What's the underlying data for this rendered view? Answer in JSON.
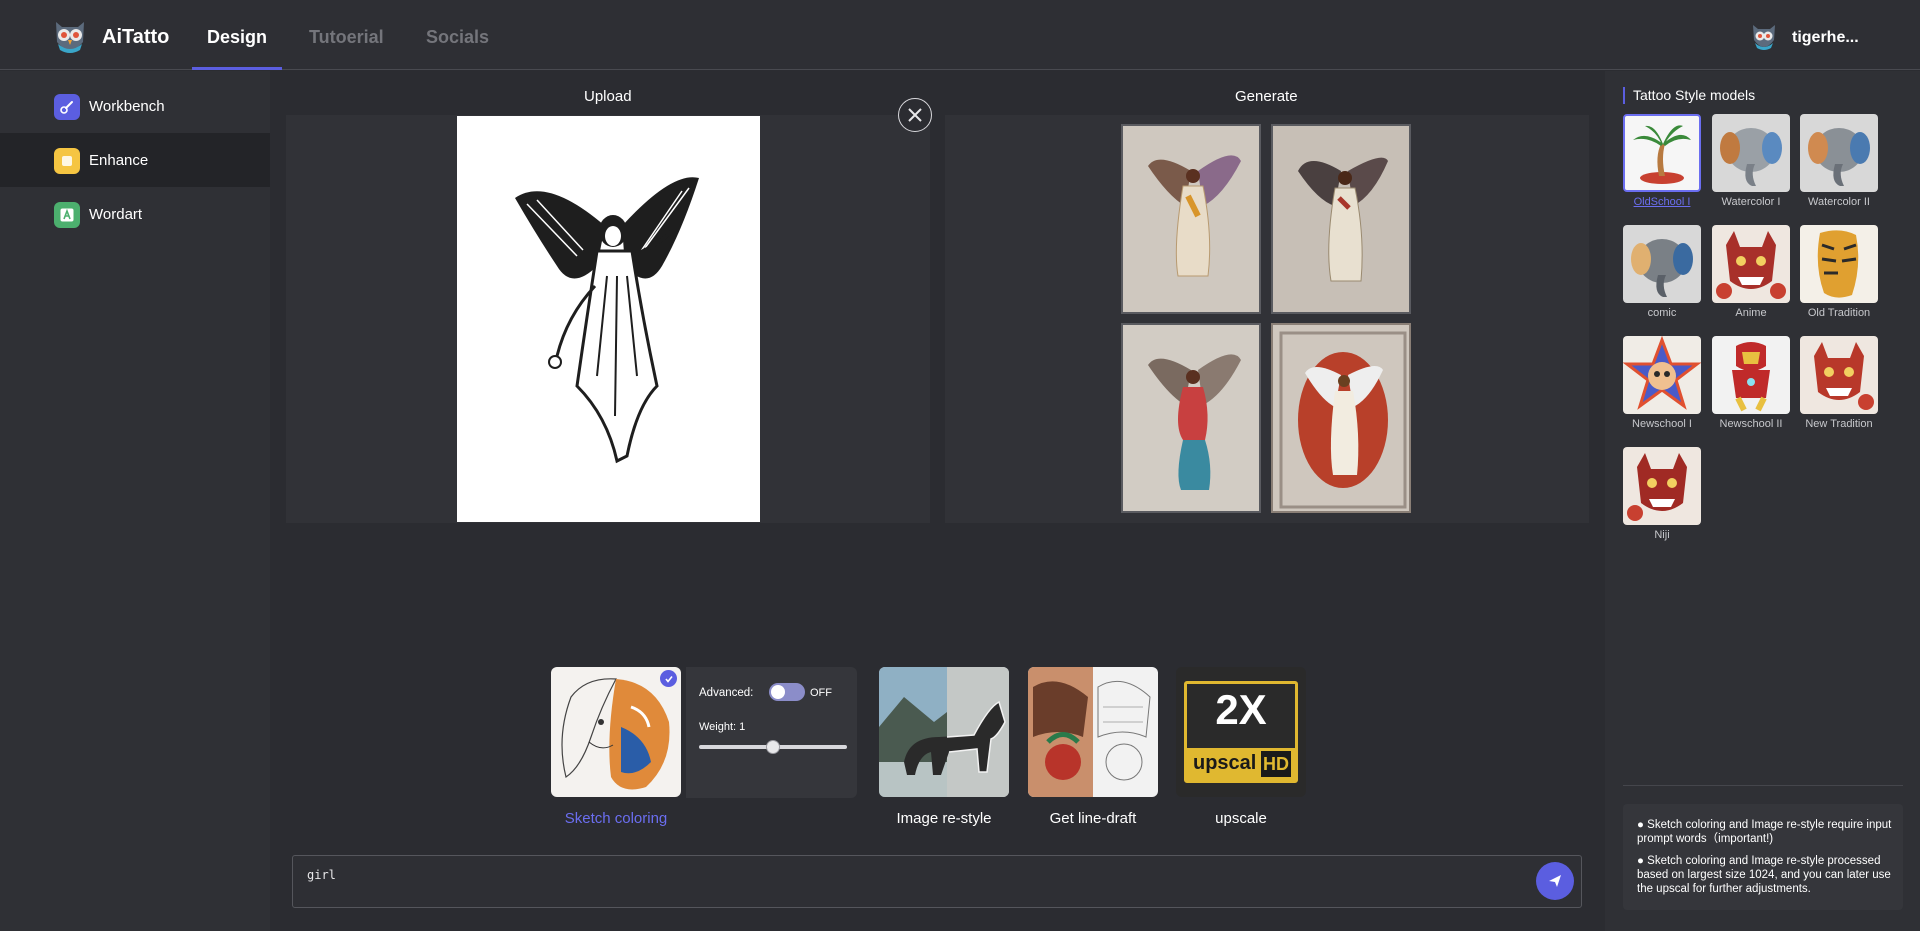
{
  "app": {
    "brand": "AiTatto",
    "username": "tigerhe..."
  },
  "nav": {
    "tabs": [
      "Design",
      "Tutoerial",
      "Socials"
    ],
    "active": "Design"
  },
  "sidebar": {
    "items": [
      {
        "label": "Workbench",
        "icon": "brush-icon",
        "color": "#5b5ee0"
      },
      {
        "label": "Enhance",
        "icon": "square-icon",
        "color": "#f5c542"
      },
      {
        "label": "Wordart",
        "icon": "letter-a-icon",
        "color": "#4caf6e"
      }
    ],
    "active": "Enhance"
  },
  "main": {
    "upload_title": "Upload",
    "generate_title": "Generate",
    "tools": [
      {
        "label": "Sketch coloring",
        "selected": true
      },
      {
        "label": "Image re-style"
      },
      {
        "label": "Get line-draft"
      },
      {
        "label": "upscale"
      }
    ],
    "advanced": {
      "label": "Advanced:",
      "toggle": "OFF",
      "weight_label": "Weight: 1",
      "weight": 1
    },
    "upscale_badge": {
      "big": "2X",
      "word": "upscal",
      "hd": "HD"
    },
    "prompt": {
      "value": "girl"
    }
  },
  "right": {
    "title": "Tattoo Style models",
    "models": [
      "OldSchool I",
      "Watercolor I",
      "Watercolor II",
      "comic",
      "Anime",
      "Old Tradition",
      "Newschool I",
      "Newschool II",
      "New Tradition",
      "Niji"
    ],
    "active": "OldSchool I",
    "notes": [
      "Sketch coloring and Image re-style require input prompt words（important!)",
      "Sketch coloring and Image re-style processed based on largest size 1024, and you can later use the upscal for further adjustments."
    ]
  },
  "colors": {
    "accent": "#5b5ee0",
    "bg": "#2b2c31"
  }
}
